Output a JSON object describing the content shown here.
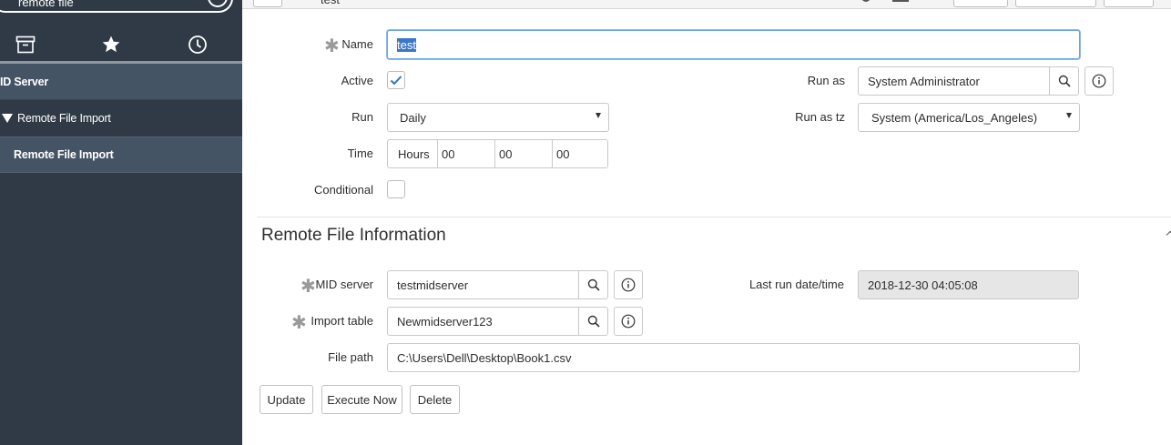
{
  "sidebar": {
    "filter_value": "remote file",
    "tabs": [
      {
        "icon": "archive-icon"
      },
      {
        "icon": "star-icon"
      },
      {
        "icon": "clock-icon"
      }
    ],
    "app_label": "ID Server",
    "module_header": "Remote File Import",
    "module_item": "Remote File Import"
  },
  "topbar": {
    "record_title": "test"
  },
  "form": {
    "name_label": "Name",
    "name_value": "test",
    "active_label": "Active",
    "active_checked": true,
    "run_as_label": "Run as",
    "run_as_value": "System Administrator",
    "run_label": "Run",
    "run_value": "Daily",
    "run_as_tz_label": "Run as tz",
    "run_as_tz_value": "System (America/Los_Angeles)",
    "time_label": "Time",
    "time_hours_label": "Hours",
    "time_h": "00",
    "time_m": "00",
    "time_s": "00",
    "conditional_label": "Conditional",
    "conditional_checked": false
  },
  "section": {
    "title": "Remote File Information",
    "mid_server_label": "MID server",
    "mid_server_value": "testmidserver",
    "last_run_label": "Last run date/time",
    "last_run_value": "2018-12-30 04:05:08",
    "import_table_label": "Import table",
    "import_table_value": "Newmidserver123",
    "file_path_label": "File path",
    "file_path_value": "C:\\Users\\Dell\\Desktop\\Book1.csv"
  },
  "buttons": {
    "update": "Update",
    "execute_now": "Execute Now",
    "delete": "Delete"
  },
  "colors": {
    "sidebar_bg": "#303a46",
    "sidebar_item_bg": "#455464",
    "focus_border": "#6aa5e3",
    "check_blue": "#2f6fbf"
  }
}
